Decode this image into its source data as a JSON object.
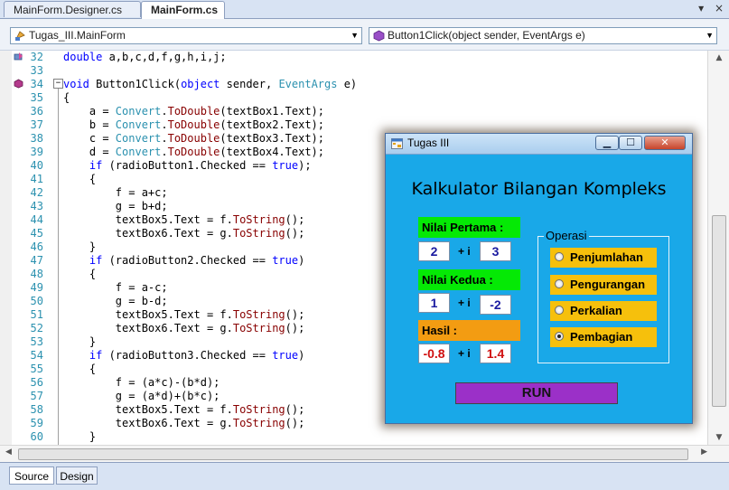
{
  "tabs": [
    {
      "label": "MainForm.Designer.cs",
      "active": false
    },
    {
      "label": "MainForm.cs",
      "active": true
    }
  ],
  "tabstrip_controls": {
    "dropdown_glyph": "▾",
    "close_glyph": "×"
  },
  "navbar": {
    "class_combo": "Tugas_III.MainForm",
    "method_combo": "Button1Click(object sender, EventArgs e)"
  },
  "editor": {
    "lines": [
      {
        "num": "32",
        "text": "        double a,b,c,d,f,g,h,i,j;"
      },
      {
        "num": "33",
        "text": ""
      },
      {
        "num": "34",
        "text": "        void Button1Click(object sender, EventArgs e)"
      },
      {
        "num": "35",
        "text": "        {"
      },
      {
        "num": "36",
        "text": "            a = Convert.ToDouble(textBox1.Text);"
      },
      {
        "num": "37",
        "text": "            b = Convert.ToDouble(textBox2.Text);"
      },
      {
        "num": "38",
        "text": "            c = Convert.ToDouble(textBox3.Text);"
      },
      {
        "num": "39",
        "text": "            d = Convert.ToDouble(textBox4.Text);"
      },
      {
        "num": "40",
        "text": "            if (radioButton1.Checked == true);"
      },
      {
        "num": "41",
        "text": "            {"
      },
      {
        "num": "42",
        "text": "                f = a+c;"
      },
      {
        "num": "43",
        "text": "                g = b+d;"
      },
      {
        "num": "44",
        "text": "                textBox5.Text = f.ToString();"
      },
      {
        "num": "45",
        "text": "                textBox6.Text = g.ToString();"
      },
      {
        "num": "46",
        "text": "            }"
      },
      {
        "num": "47",
        "text": "            if (radioButton2.Checked == true)"
      },
      {
        "num": "48",
        "text": "            {"
      },
      {
        "num": "49",
        "text": "                f = a-c;"
      },
      {
        "num": "50",
        "text": "                g = b-d;"
      },
      {
        "num": "51",
        "text": "                textBox5.Text = f.ToString();"
      },
      {
        "num": "52",
        "text": "                textBox6.Text = g.ToString();"
      },
      {
        "num": "53",
        "text": "            }"
      },
      {
        "num": "54",
        "text": "            if (radioButton3.Checked == true)"
      },
      {
        "num": "55",
        "text": "            {"
      },
      {
        "num": "56",
        "text": "                f = (a*c)-(b*d);"
      },
      {
        "num": "57",
        "text": "                g = (a*d)+(b*c);"
      },
      {
        "num": "58",
        "text": "                textBox5.Text = f.ToString();"
      },
      {
        "num": "59",
        "text": "                textBox6.Text = g.ToString();"
      },
      {
        "num": "60",
        "text": "            }"
      }
    ]
  },
  "form": {
    "title": "Tugas III",
    "heading": "Kalkulator Bilangan Kompleks",
    "label_first": "Nilai Pertama :",
    "label_second": "Nilai Kedua :",
    "label_result": "Hasil :",
    "plus_i": "+ i",
    "first_real": "2",
    "first_imag": "3",
    "second_real": "1",
    "second_imag": "-2",
    "result_real": "-0.8",
    "result_imag": "1.4",
    "group_label": "Operasi",
    "options": [
      {
        "label": "Penjumlahan",
        "checked": false
      },
      {
        "label": "Pengurangan",
        "checked": false
      },
      {
        "label": "Perkalian",
        "checked": false
      },
      {
        "label": "Pembagian",
        "checked": true
      }
    ],
    "run_label": "RUN",
    "window_buttons": {
      "minimize": "▁",
      "maximize": "☐",
      "close": "✕"
    }
  },
  "view_tabs": [
    "Source",
    "Design"
  ],
  "colors": {
    "form_bg": "#19a8e8",
    "green_label": "#05e905",
    "orange_label": "#f39c12",
    "option_bg": "#f6c00c",
    "run_bg": "#9b30c8",
    "keyword": "#0000ff",
    "type": "#2b91af",
    "method": "#880000",
    "line_number": "#2b91af"
  }
}
